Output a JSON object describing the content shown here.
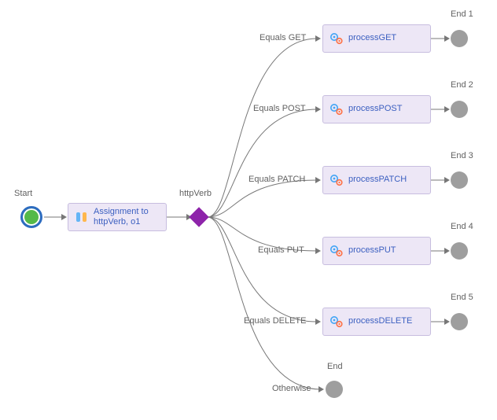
{
  "start": {
    "label": "Start"
  },
  "assignment": {
    "label": "Assignment to httpVerb, o1"
  },
  "decision": {
    "label": "httpVerb"
  },
  "branches": [
    {
      "condition": "Equals GET",
      "process": "processGET",
      "endLabel": "End 1"
    },
    {
      "condition": "Equals POST",
      "process": "processPOST",
      "endLabel": "End 2"
    },
    {
      "condition": "Equals PATCH",
      "process": "processPATCH",
      "endLabel": "End 3"
    },
    {
      "condition": "Equals PUT",
      "process": "processPUT",
      "endLabel": "End 4"
    },
    {
      "condition": "Equals DELETE",
      "process": "processDELETE",
      "endLabel": "End 5"
    }
  ],
  "otherwise": {
    "condition": "Otherwise",
    "endLabel": "End"
  },
  "colors": {
    "nodeFill": "#ede7f6",
    "nodeBorder": "#c7bddf",
    "linkText": "#3b5fc0",
    "labelText": "#616161",
    "start": "#54b948",
    "startRing": "#2d6cc0",
    "end": "#9e9e9e",
    "diamond": "#8e24aa",
    "edge": "#777777"
  }
}
